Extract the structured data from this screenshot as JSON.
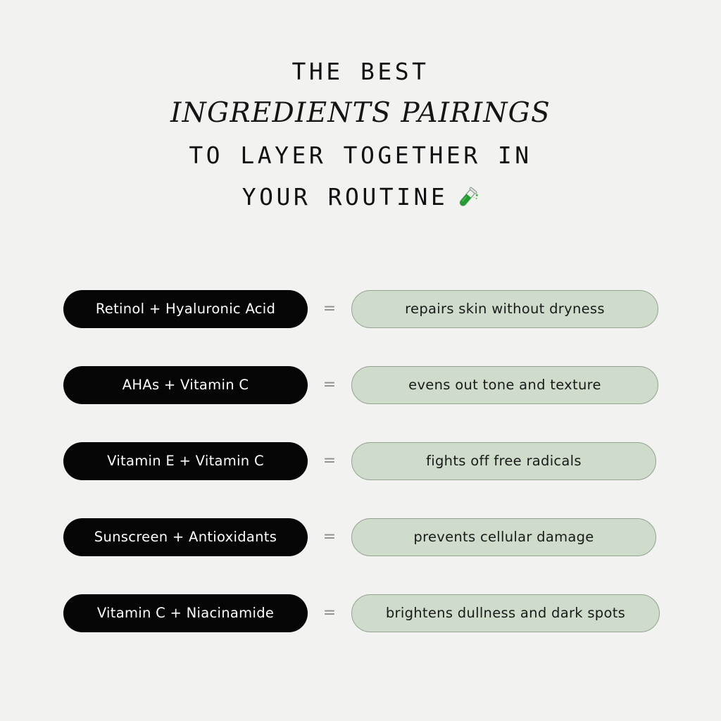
{
  "background_color": "#f2f2f0",
  "title": {
    "line1": "THE BEST",
    "line2": "INGREDIENTS PAIRINGS",
    "line3": "TO LAYER TOGETHER IN",
    "line4": "YOUR ROUTINE",
    "emoji_name": "test-tube-emoji",
    "emoji_char": "🧪"
  },
  "colors": {
    "pill_dark_bg": "#050505",
    "pill_dark_text": "#ffffff",
    "pill_green_bg": "#cfdccb",
    "pill_green_border": "#93a390",
    "pill_green_text": "#1a1a1a",
    "equals_sign": "#8d8d8d",
    "title_text": "#111111",
    "emoji_green": "#2aa037"
  },
  "equals_symbol": "=",
  "pairings": [
    {
      "ingredients": "Retinol + Hyaluronic Acid",
      "benefit": "repairs skin without dryness"
    },
    {
      "ingredients": "AHAs + Vitamin C",
      "benefit": "evens out tone and texture"
    },
    {
      "ingredients": "Vitamin E + Vitamin C",
      "benefit": "fights off free radicals"
    },
    {
      "ingredients": "Sunscreen + Antioxidants",
      "benefit": "prevents cellular damage"
    },
    {
      "ingredients": "Vitamin C + Niacinamide",
      "benefit": "brightens dullness and dark spots"
    }
  ]
}
